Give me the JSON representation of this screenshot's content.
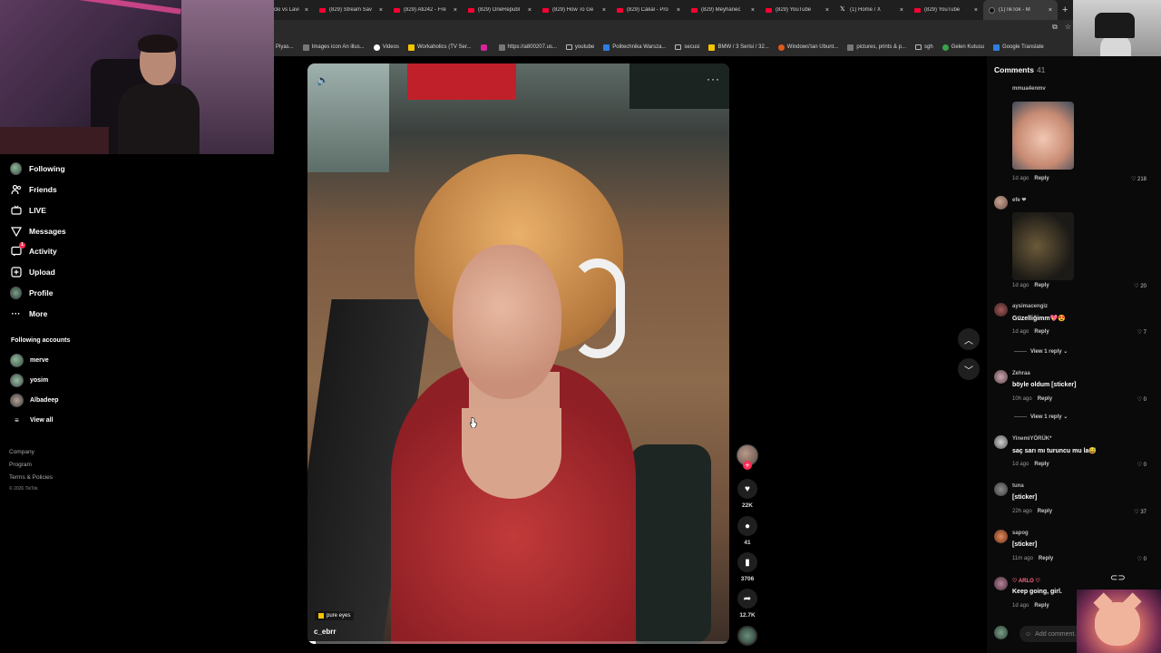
{
  "tabs": [
    {
      "title": "cki vs Lavi",
      "fav": "none",
      "active": false
    },
    {
      "title": "(829) Stream Sav",
      "fav": "yt",
      "active": false
    },
    {
      "title": "(829) Ati242 - Fre",
      "fav": "yt",
      "active": false
    },
    {
      "title": "(829) OneRepubl",
      "fav": "yt",
      "active": false
    },
    {
      "title": "(829) How To Ge",
      "fav": "yt",
      "active": false
    },
    {
      "title": "(829) Cakal - Pro",
      "fav": "yt",
      "active": false
    },
    {
      "title": "(829) Meyhanec",
      "fav": "yt",
      "active": false
    },
    {
      "title": "(829) YouTube",
      "fav": "yt",
      "active": false
    },
    {
      "title": "(1) Home / X",
      "fav": "x",
      "active": false
    },
    {
      "title": "(829) YouTube",
      "fav": "yt",
      "active": false
    },
    {
      "title": "(1)TikTok - M",
      "fav": "tt",
      "active": true
    }
  ],
  "bookmarks": [
    {
      "label": "Piyas...",
      "icon": "none"
    },
    {
      "label": "Images icon An illus...",
      "icon": "page"
    },
    {
      "label": "Videos",
      "icon": "g"
    },
    {
      "label": "Workaholics (TV Ser...",
      "icon": "y"
    },
    {
      "label": "",
      "icon": "ig"
    },
    {
      "label": "https://a800207.us...",
      "icon": "page"
    },
    {
      "label": "youtube",
      "icon": "folder"
    },
    {
      "label": "Politechnika Warsza...",
      "icon": "b"
    },
    {
      "label": "secusi",
      "icon": "folder"
    },
    {
      "label": "BMW / 3 Serisi / 32...",
      "icon": "y"
    },
    {
      "label": "Windows'tan Ubunt...",
      "icon": "o"
    },
    {
      "label": "pictures, prints & p...",
      "icon": "page"
    },
    {
      "label": "sgh",
      "icon": "folder"
    },
    {
      "label": "Gelen Kutusu",
      "icon": "gr"
    },
    {
      "label": "Google Translate",
      "icon": "b"
    }
  ],
  "sidebar": {
    "nav": [
      {
        "label": "Following",
        "icon": "following-icon"
      },
      {
        "label": "Friends",
        "icon": "friends-icon"
      },
      {
        "label": "LIVE",
        "icon": "live-icon"
      },
      {
        "label": "Messages",
        "icon": "messages-icon"
      },
      {
        "label": "Activity",
        "icon": "activity-icon",
        "badge": "1"
      },
      {
        "label": "Upload",
        "icon": "upload-icon"
      },
      {
        "label": "Profile",
        "icon": "profile-icon"
      },
      {
        "label": "More",
        "icon": "more-icon"
      }
    ],
    "following_title": "Following accounts",
    "accounts": [
      "merve",
      "yosim",
      "Albadeep"
    ],
    "view_all": "View all",
    "footer": [
      "Company",
      "Program",
      "Terms & Policies"
    ],
    "copyright": "© 2026 TikTok"
  },
  "video": {
    "tag": "pure eyes",
    "username": "c_ebrr",
    "more": "···",
    "progress": 0.02
  },
  "actions": {
    "likes": "22K",
    "comments": "41",
    "saves": "3706",
    "shares": "12.7K"
  },
  "comments": {
    "title": "Comments",
    "count": "41",
    "items": [
      {
        "name": "mmua4enmv",
        "text": "",
        "time": "1d ago",
        "likes": "218",
        "image": "a"
      },
      {
        "name": "efe ❤",
        "text": "",
        "time": "1d ago",
        "likes": "20",
        "image": "b"
      },
      {
        "name": "aysimacengiz",
        "text": "Güzelliğimm💖😍",
        "time": "1d ago",
        "likes": "7",
        "view_replies": "View 1 reply"
      },
      {
        "name": "Zehraa",
        "text": "böyle oldum [sticker]",
        "time": "10h ago",
        "likes": "0",
        "view_replies": "View 1 reply"
      },
      {
        "name": "YinemiYÖRÜK*",
        "text": "saç sarı mı turuncu mu la😅",
        "time": "1d ago",
        "likes": "0"
      },
      {
        "name": "tuna",
        "text": "[sticker]",
        "time": "22h ago",
        "likes": "37"
      },
      {
        "name": "sapog",
        "text": "[sticker]",
        "time": "11m ago",
        "likes": "0"
      },
      {
        "name": "♡ ARLO ♡",
        "text": "Keep going, girl.",
        "time": "1d ago",
        "likes": ""
      }
    ],
    "reply_label": "Reply",
    "add_placeholder": "Add comment..."
  }
}
